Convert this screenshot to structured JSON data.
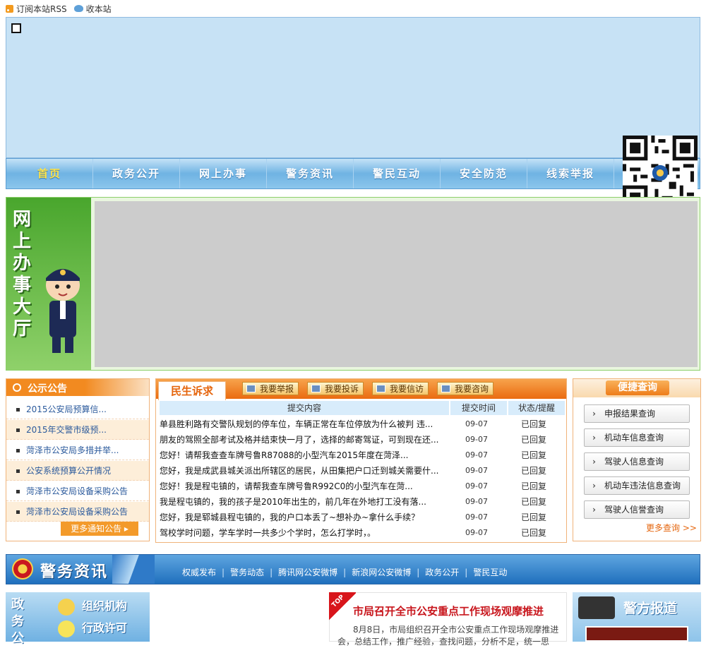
{
  "topbar": {
    "rss_label": "订阅本站RSS",
    "fav_label": "收本站"
  },
  "nav": {
    "items": [
      "首页",
      "政务公开",
      "网上办事",
      "警务资讯",
      "警民互动",
      "安全防范",
      "线索举报"
    ]
  },
  "hall": {
    "title": "网上办事大厅"
  },
  "notice": {
    "title": "公示公告",
    "items": [
      "2015公安局预算信...",
      "2015年交警市级预...",
      "菏泽市公安局多措并举...",
      "公安系统预算公开情况",
      "菏泽市公安局设备采购公告",
      "菏泽市公安局设备采购公告"
    ],
    "more_label": "更多通知公告"
  },
  "appeal": {
    "title": "民生诉求",
    "buttons": [
      "我要举报",
      "我要投诉",
      "我要信访",
      "我要咨询"
    ],
    "columns": [
      "提交内容",
      "提交时间",
      "状态/提醒"
    ],
    "rows": [
      [
        "单县胜利路有交警队规划的停车位，车辆正常在车位停放为什么被判 违...",
        "09-07",
        "已回复"
      ],
      [
        "朋友的驾照全部考试及格并结束快一月了，选择的邮寄驾证，可到现在还...",
        "09-07",
        "已回复"
      ],
      [
        "您好！请帮我查查车牌号鲁R87088的小型汽车2015年度在菏泽...",
        "09-07",
        "已回复"
      ],
      [
        "您好，我是成武县城关派出所辖区的居民，从田集把户口迁到城关需要什...",
        "09-07",
        "已回复"
      ],
      [
        "您好！我是程屯镇的，请帮我查车牌号鲁R992C0的小型汽车在菏...",
        "09-07",
        "已回复"
      ],
      [
        "我是程屯镇的，我的孩子是2010年出生的，前几年在外地打工没有落...",
        "09-07",
        "已回复"
      ],
      [
        "您好，我是郓城县程屯镇的，我的户口本丢了~想补办~拿什么手续？",
        "09-07",
        "已回复"
      ],
      [
        "驾校学时问题，学车学时一共多少个学时，怎么打学时，。",
        "09-07",
        "已回复"
      ]
    ]
  },
  "quick": {
    "title": "便捷查询",
    "buttons": [
      "申报结果查询",
      "机动车信息查询",
      "驾驶人信息查询",
      "机动车违法信息查询",
      "驾驶人信誉查询"
    ],
    "more_label": "更多查询 >>"
  },
  "newsbar": {
    "title": "警务资讯",
    "links": [
      "权威发布",
      "警务动态",
      "腾讯网公安微博",
      "新浪网公安微博",
      "政务公开",
      "警民互动"
    ]
  },
  "gov": {
    "side_title": "政务公",
    "buttons": [
      "组织机构",
      "行政许可"
    ]
  },
  "headline": {
    "ribbon": "TOP",
    "title": "市局召开全市公安重点工作现场观摩推进",
    "text": "8月8日，市局组织召开全市公安重点工作现场观摩推进会，总结工作，推广经验，查找问题，分析不足，统一思"
  },
  "report": {
    "title": "警方报道"
  },
  "colors": {
    "nav_active": "#ffe44a",
    "accent_orange": "#f28a20",
    "headline_red": "#c8161d"
  }
}
